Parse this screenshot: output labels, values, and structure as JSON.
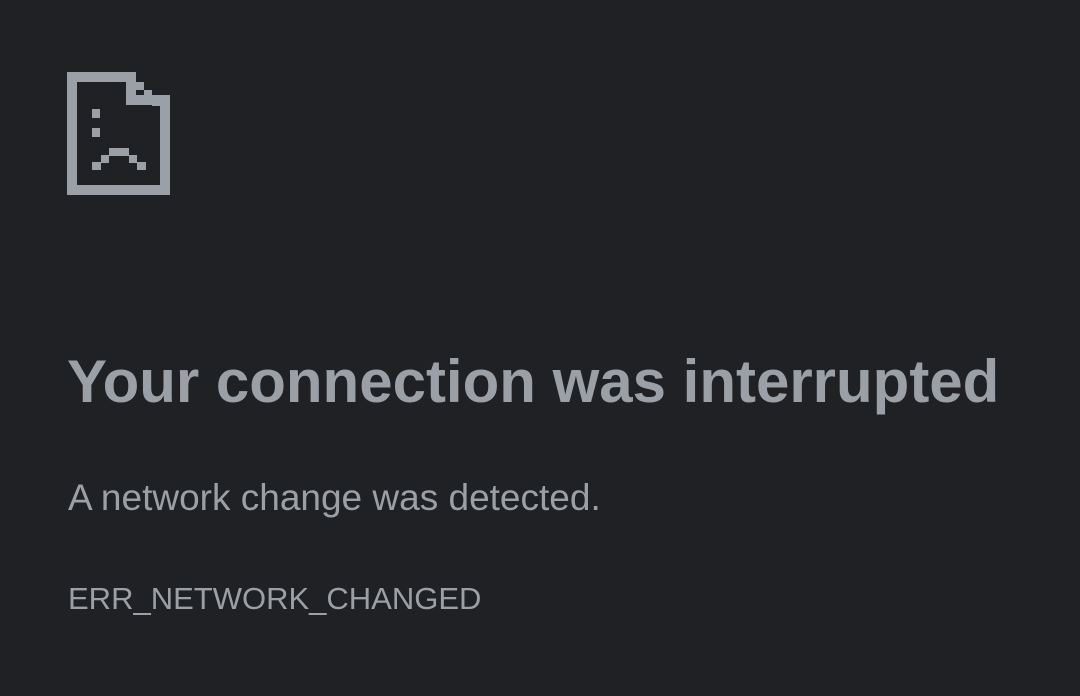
{
  "theme": {
    "background": "#202124",
    "icon_color": "#9aa0a6",
    "title_color": "#9aa0a6",
    "message_color": "#9aa0a6",
    "code_color": "#9aa0a6"
  },
  "error_page": {
    "icon": "sad-document-icon",
    "title": "Your connection was interrupted",
    "message": "A network change was detected.",
    "code": "ERR_NETWORK_CHANGED"
  }
}
